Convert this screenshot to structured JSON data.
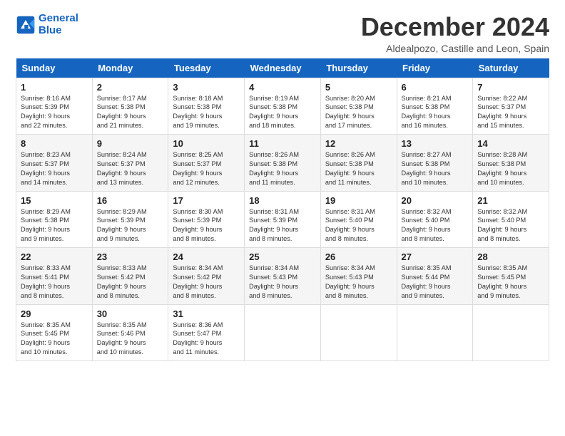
{
  "logo": {
    "line1": "General",
    "line2": "Blue"
  },
  "title": "December 2024",
  "location": "Aldealpozo, Castille and Leon, Spain",
  "days_of_week": [
    "Sunday",
    "Monday",
    "Tuesday",
    "Wednesday",
    "Thursday",
    "Friday",
    "Saturday"
  ],
  "weeks": [
    [
      {
        "day": "1",
        "sunrise": "8:16 AM",
        "sunset": "5:39 PM",
        "daylight_hours": "9",
        "daylight_minutes": "22"
      },
      {
        "day": "2",
        "sunrise": "8:17 AM",
        "sunset": "5:38 PM",
        "daylight_hours": "9",
        "daylight_minutes": "21"
      },
      {
        "day": "3",
        "sunrise": "8:18 AM",
        "sunset": "5:38 PM",
        "daylight_hours": "9",
        "daylight_minutes": "19"
      },
      {
        "day": "4",
        "sunrise": "8:19 AM",
        "sunset": "5:38 PM",
        "daylight_hours": "9",
        "daylight_minutes": "18"
      },
      {
        "day": "5",
        "sunrise": "8:20 AM",
        "sunset": "5:38 PM",
        "daylight_hours": "9",
        "daylight_minutes": "17"
      },
      {
        "day": "6",
        "sunrise": "8:21 AM",
        "sunset": "5:38 PM",
        "daylight_hours": "9",
        "daylight_minutes": "16"
      },
      {
        "day": "7",
        "sunrise": "8:22 AM",
        "sunset": "5:37 PM",
        "daylight_hours": "9",
        "daylight_minutes": "15"
      }
    ],
    [
      {
        "day": "8",
        "sunrise": "8:23 AM",
        "sunset": "5:37 PM",
        "daylight_hours": "9",
        "daylight_minutes": "14"
      },
      {
        "day": "9",
        "sunrise": "8:24 AM",
        "sunset": "5:37 PM",
        "daylight_hours": "9",
        "daylight_minutes": "13"
      },
      {
        "day": "10",
        "sunrise": "8:25 AM",
        "sunset": "5:37 PM",
        "daylight_hours": "9",
        "daylight_minutes": "12"
      },
      {
        "day": "11",
        "sunrise": "8:26 AM",
        "sunset": "5:38 PM",
        "daylight_hours": "9",
        "daylight_minutes": "11"
      },
      {
        "day": "12",
        "sunrise": "8:26 AM",
        "sunset": "5:38 PM",
        "daylight_hours": "9",
        "daylight_minutes": "11"
      },
      {
        "day": "13",
        "sunrise": "8:27 AM",
        "sunset": "5:38 PM",
        "daylight_hours": "9",
        "daylight_minutes": "10"
      },
      {
        "day": "14",
        "sunrise": "8:28 AM",
        "sunset": "5:38 PM",
        "daylight_hours": "9",
        "daylight_minutes": "10"
      }
    ],
    [
      {
        "day": "15",
        "sunrise": "8:29 AM",
        "sunset": "5:38 PM",
        "daylight_hours": "9",
        "daylight_minutes": "9"
      },
      {
        "day": "16",
        "sunrise": "8:29 AM",
        "sunset": "5:39 PM",
        "daylight_hours": "9",
        "daylight_minutes": "9"
      },
      {
        "day": "17",
        "sunrise": "8:30 AM",
        "sunset": "5:39 PM",
        "daylight_hours": "9",
        "daylight_minutes": "8"
      },
      {
        "day": "18",
        "sunrise": "8:31 AM",
        "sunset": "5:39 PM",
        "daylight_hours": "9",
        "daylight_minutes": "8"
      },
      {
        "day": "19",
        "sunrise": "8:31 AM",
        "sunset": "5:40 PM",
        "daylight_hours": "9",
        "daylight_minutes": "8"
      },
      {
        "day": "20",
        "sunrise": "8:32 AM",
        "sunset": "5:40 PM",
        "daylight_hours": "9",
        "daylight_minutes": "8"
      },
      {
        "day": "21",
        "sunrise": "8:32 AM",
        "sunset": "5:40 PM",
        "daylight_hours": "9",
        "daylight_minutes": "8"
      }
    ],
    [
      {
        "day": "22",
        "sunrise": "8:33 AM",
        "sunset": "5:41 PM",
        "daylight_hours": "9",
        "daylight_minutes": "8"
      },
      {
        "day": "23",
        "sunrise": "8:33 AM",
        "sunset": "5:42 PM",
        "daylight_hours": "9",
        "daylight_minutes": "8"
      },
      {
        "day": "24",
        "sunrise": "8:34 AM",
        "sunset": "5:42 PM",
        "daylight_hours": "9",
        "daylight_minutes": "8"
      },
      {
        "day": "25",
        "sunrise": "8:34 AM",
        "sunset": "5:43 PM",
        "daylight_hours": "9",
        "daylight_minutes": "8"
      },
      {
        "day": "26",
        "sunrise": "8:34 AM",
        "sunset": "5:43 PM",
        "daylight_hours": "9",
        "daylight_minutes": "8"
      },
      {
        "day": "27",
        "sunrise": "8:35 AM",
        "sunset": "5:44 PM",
        "daylight_hours": "9",
        "daylight_minutes": "9"
      },
      {
        "day": "28",
        "sunrise": "8:35 AM",
        "sunset": "5:45 PM",
        "daylight_hours": "9",
        "daylight_minutes": "9"
      }
    ],
    [
      {
        "day": "29",
        "sunrise": "8:35 AM",
        "sunset": "5:45 PM",
        "daylight_hours": "9",
        "daylight_minutes": "10"
      },
      {
        "day": "30",
        "sunrise": "8:35 AM",
        "sunset": "5:46 PM",
        "daylight_hours": "9",
        "daylight_minutes": "10"
      },
      {
        "day": "31",
        "sunrise": "8:36 AM",
        "sunset": "5:47 PM",
        "daylight_hours": "9",
        "daylight_minutes": "11"
      },
      null,
      null,
      null,
      null
    ]
  ]
}
